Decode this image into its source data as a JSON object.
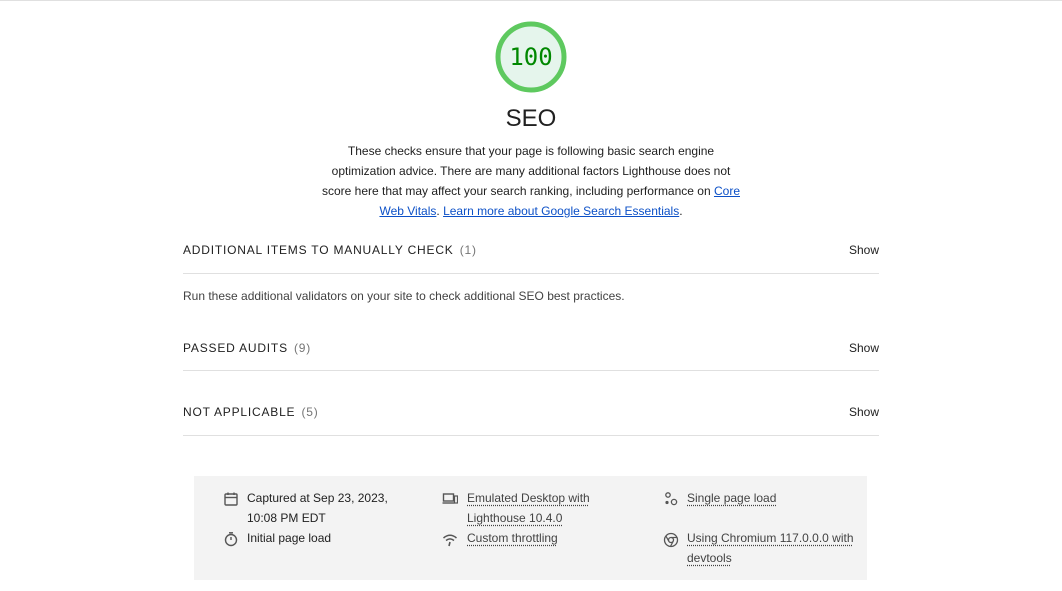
{
  "category": {
    "score": "100",
    "score_color": "#0cce6b",
    "title": "SEO",
    "description": "These checks ensure that your page is following basic search engine optimization advice. There are many additional factors Lighthouse does not score here that may affect your search ranking, including performance on",
    "link_core_web_vitals": "Core Web Vitals",
    "link_separator": ".",
    "link_learn_more": "Learn more about Google Search Essentials",
    "link_end": "."
  },
  "groups": [
    {
      "title": "Additional items to manually check",
      "count": "(1)",
      "toggle": "Show",
      "note": "Run these additional validators on your site to check additional SEO best practices."
    },
    {
      "title": "Passed audits",
      "count": "(9)",
      "toggle": "Show"
    },
    {
      "title": "Not applicable",
      "count": "(5)",
      "toggle": "Show"
    }
  ],
  "footer": {
    "captured": "Captured at Sep 23, 2023, 10:08 PM EDT",
    "initial_load": "Initial page load",
    "emulated": "Emulated Desktop with Lighthouse 10.4.0",
    "throttling": "Custom throttling",
    "single_load": "Single page load",
    "chromium": "Using Chromium 117.0.0.0 with devtools",
    "icons": [
      "calendar-icon",
      "stopwatch-icon",
      "desktop-icon",
      "wifi-icon",
      "single-load-icon",
      "chromium-icon"
    ]
  }
}
